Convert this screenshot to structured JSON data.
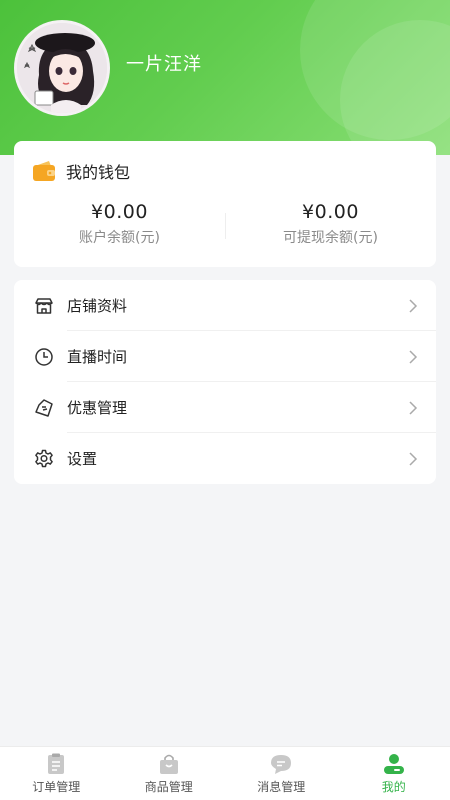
{
  "profile": {
    "username": "一片汪洋",
    "avatar_icon": "avatar-girl-illustration"
  },
  "wallet": {
    "title": "我的钱包",
    "icon": "wallet-icon",
    "balance": {
      "amount": "¥0.00",
      "label": "账户余额(元)"
    },
    "withdrawable": {
      "amount": "¥0.00",
      "label": "可提现余额(元)"
    }
  },
  "menu": {
    "items": [
      {
        "label": "店铺资料",
        "icon": "store-icon"
      },
      {
        "label": "直播时间",
        "icon": "clock-icon"
      },
      {
        "label": "优惠管理",
        "icon": "coupon-icon"
      },
      {
        "label": "设置",
        "icon": "gear-icon"
      }
    ]
  },
  "tabbar": {
    "tabs": [
      {
        "label": "订单管理",
        "icon": "order-list-icon",
        "active": false
      },
      {
        "label": "商品管理",
        "icon": "shopping-bag-icon",
        "active": false
      },
      {
        "label": "消息管理",
        "icon": "message-bubble-icon",
        "active": false
      },
      {
        "label": "我的",
        "icon": "user-profile-icon",
        "active": true
      }
    ]
  },
  "colors": {
    "brand_green": "#4cc13b",
    "active_tab": "#34b34a",
    "wallet_orange": "#f5a623"
  }
}
